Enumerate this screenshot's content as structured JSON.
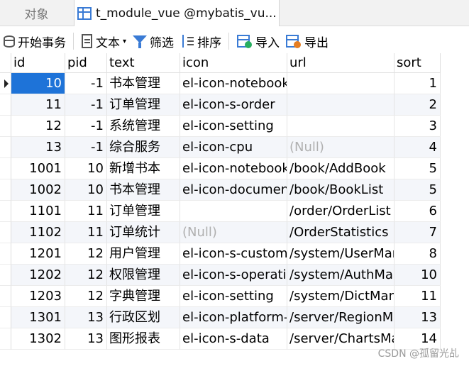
{
  "tabs": {
    "objects": "对象",
    "table": "t_module_vue @mybatis_vu..."
  },
  "toolbar": {
    "begin_transaction": "开始事务",
    "text": "文本",
    "filter": "筛选",
    "sort": "排序",
    "import": "导入",
    "export": "导出"
  },
  "columns": [
    "id",
    "pid",
    "text",
    "icon",
    "url",
    "sort"
  ],
  "rows": [
    {
      "id": "10",
      "pid": "-1",
      "text": "书本管理",
      "icon": "el-icon-notebook",
      "url": "",
      "sort": "1"
    },
    {
      "id": "11",
      "pid": "-1",
      "text": "订单管理",
      "icon": "el-icon-s-order",
      "url": "",
      "sort": "2"
    },
    {
      "id": "12",
      "pid": "-1",
      "text": "系统管理",
      "icon": "el-icon-setting",
      "url": "",
      "sort": "3"
    },
    {
      "id": "13",
      "pid": "-1",
      "text": "综合服务",
      "icon": "el-icon-cpu",
      "url": "(Null)",
      "sort": "4"
    },
    {
      "id": "1001",
      "pid": "10",
      "text": "新增书本",
      "icon": "el-icon-notebook",
      "url": "/book/AddBook",
      "sort": "5"
    },
    {
      "id": "1002",
      "pid": "10",
      "text": "书本管理",
      "icon": "el-icon-documen",
      "url": "/book/BookList",
      "sort": "5"
    },
    {
      "id": "1101",
      "pid": "11",
      "text": "订单管理",
      "icon": "",
      "url": "/order/OrderList",
      "sort": "6"
    },
    {
      "id": "1102",
      "pid": "11",
      "text": "订单统计",
      "icon": "(Null)",
      "url": "/OrderStatistics",
      "sort": "7"
    },
    {
      "id": "1201",
      "pid": "12",
      "text": "用户管理",
      "icon": "el-icon-s-custom",
      "url": "/system/UserMan",
      "sort": "8"
    },
    {
      "id": "1202",
      "pid": "12",
      "text": "权限管理",
      "icon": "el-icon-s-operatio",
      "url": "/system/AuthMa",
      "sort": "10"
    },
    {
      "id": "1203",
      "pid": "12",
      "text": "字典管理",
      "icon": "el-icon-setting",
      "url": "/system/DictMan",
      "sort": "11"
    },
    {
      "id": "1301",
      "pid": "13",
      "text": "行政区划",
      "icon": "el-icon-platform-",
      "url": "/server/RegionMa",
      "sort": "13"
    },
    {
      "id": "1302",
      "pid": "13",
      "text": "图形报表",
      "icon": "el-icon-s-data",
      "url": "/server/ChartsMa",
      "sort": "14"
    }
  ],
  "watermark": "CSDN @孤留光乩"
}
